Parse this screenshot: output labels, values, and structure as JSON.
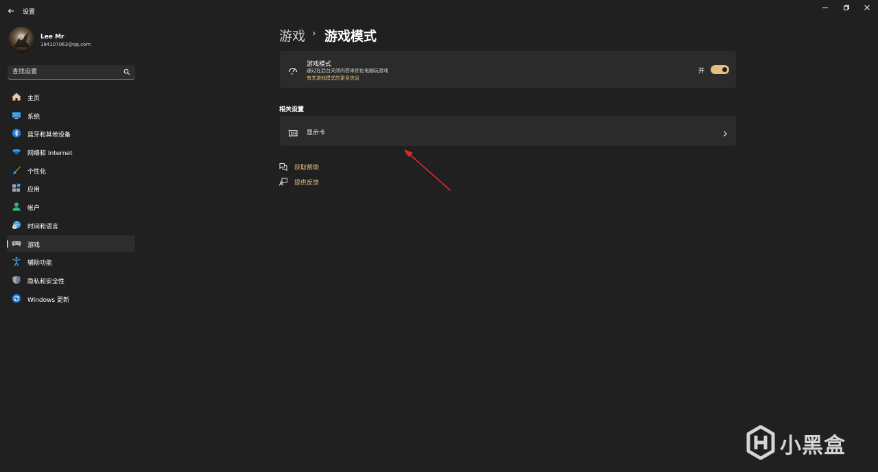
{
  "window": {
    "title": "设置"
  },
  "user": {
    "name": "Lee Mr",
    "email": "184107063@qq.com"
  },
  "search": {
    "placeholder": "查找设置"
  },
  "sidebar": {
    "items": [
      {
        "label": "主页",
        "icon": "home-icon",
        "active": false
      },
      {
        "label": "系统",
        "icon": "monitor-icon",
        "active": false
      },
      {
        "label": "蓝牙和其他设备",
        "icon": "bluetooth-icon",
        "active": false
      },
      {
        "label": "网络和 Internet",
        "icon": "wifi-icon",
        "active": false
      },
      {
        "label": "个性化",
        "icon": "brush-icon",
        "active": false
      },
      {
        "label": "应用",
        "icon": "apps-icon",
        "active": false
      },
      {
        "label": "帐户",
        "icon": "person-icon",
        "active": false
      },
      {
        "label": "时间和语言",
        "icon": "globe-clock-icon",
        "active": false
      },
      {
        "label": "游戏",
        "icon": "gamepad-icon",
        "active": true
      },
      {
        "label": "辅助功能",
        "icon": "accessibility-icon",
        "active": false
      },
      {
        "label": "隐私和安全性",
        "icon": "shield-icon",
        "active": false
      },
      {
        "label": "Windows 更新",
        "icon": "update-icon",
        "active": false
      }
    ]
  },
  "breadcrumb": {
    "parent": "游戏",
    "separator": "›",
    "current": "游戏模式"
  },
  "game_mode_card": {
    "title": "游戏模式",
    "description": "通过在后台关闭内容来优化电脑玩游戏",
    "link": "有关游戏模式的更多信息",
    "toggle_label": "开",
    "toggle_on": true
  },
  "related": {
    "title": "相关设置",
    "items": [
      {
        "label": "显示卡",
        "icon": "graphics-card-icon"
      }
    ]
  },
  "help": {
    "get_help": "获取帮助",
    "feedback": "提供反馈"
  },
  "watermark": {
    "text": "小黑盒"
  },
  "colors": {
    "background": "#202020",
    "card": "#2b2b2b",
    "accent": "#e6c07b",
    "arrow": "#e0282d"
  }
}
